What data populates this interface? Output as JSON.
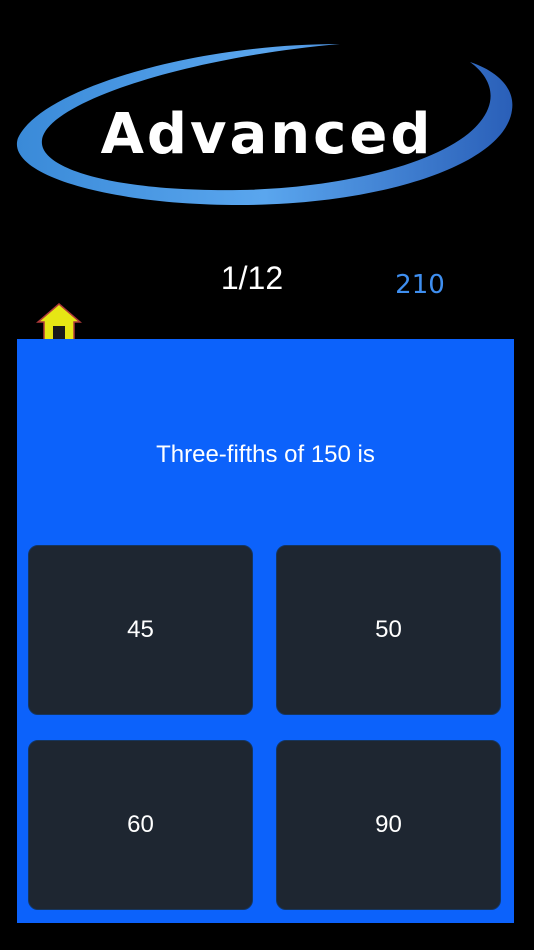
{
  "logo": {
    "text": "Advanced"
  },
  "progress": "1/12",
  "score": "210",
  "question": "Three-fifths of 150 is",
  "answers": [
    "45",
    "50",
    "60",
    "90"
  ],
  "colors": {
    "background": "#000000",
    "panel": "#0c62fb",
    "answer_button": "#1e2631",
    "score_text": "#3f8ff0",
    "home_icon": "#e6e614"
  },
  "icons": {
    "home": "home-icon",
    "logo_swoosh": "swoosh-icon"
  }
}
